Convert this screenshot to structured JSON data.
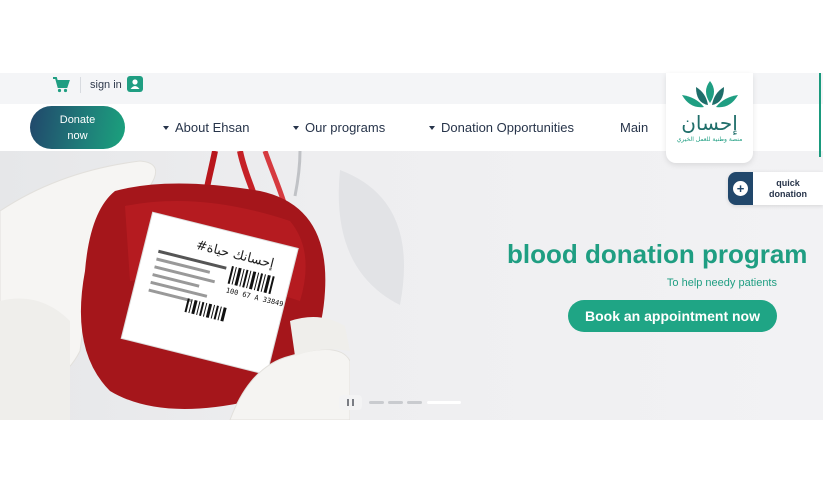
{
  "topbar": {
    "cart_icon": "shopping-cart-icon",
    "signin_label": "sign in",
    "user_icon": "user-account-icon"
  },
  "nav": {
    "donate_line1": "Donate",
    "donate_line2": "now",
    "items": [
      {
        "label": "About Ehsan",
        "icon": "caret-down-icon"
      },
      {
        "label": "Our programs",
        "icon": "caret-down-icon"
      },
      {
        "label": "Donation Opportunities",
        "icon": "caret-down-icon"
      },
      {
        "label": "Main"
      }
    ]
  },
  "logo": {
    "name": "إحسان",
    "tagline": "منصة وطنية للعمل الخيري"
  },
  "quick_donation": {
    "icon": "plus-circle-icon",
    "line1": "quick",
    "line2": "donation"
  },
  "hero": {
    "title": "blood donation program",
    "subtitle": "To help needy patients",
    "cta_label": "Book an appointment now",
    "bag_label": "#إحسانك حياة",
    "bag_code": "100 67 A 33849"
  },
  "slider": {
    "slides": 4,
    "active_slide": 4,
    "pause_icon": "pause-icon"
  },
  "colors": {
    "brand_green": "#1f9e82",
    "navy": "#21476b",
    "text_dark": "#27344a",
    "blood_red": "#a5161b"
  }
}
